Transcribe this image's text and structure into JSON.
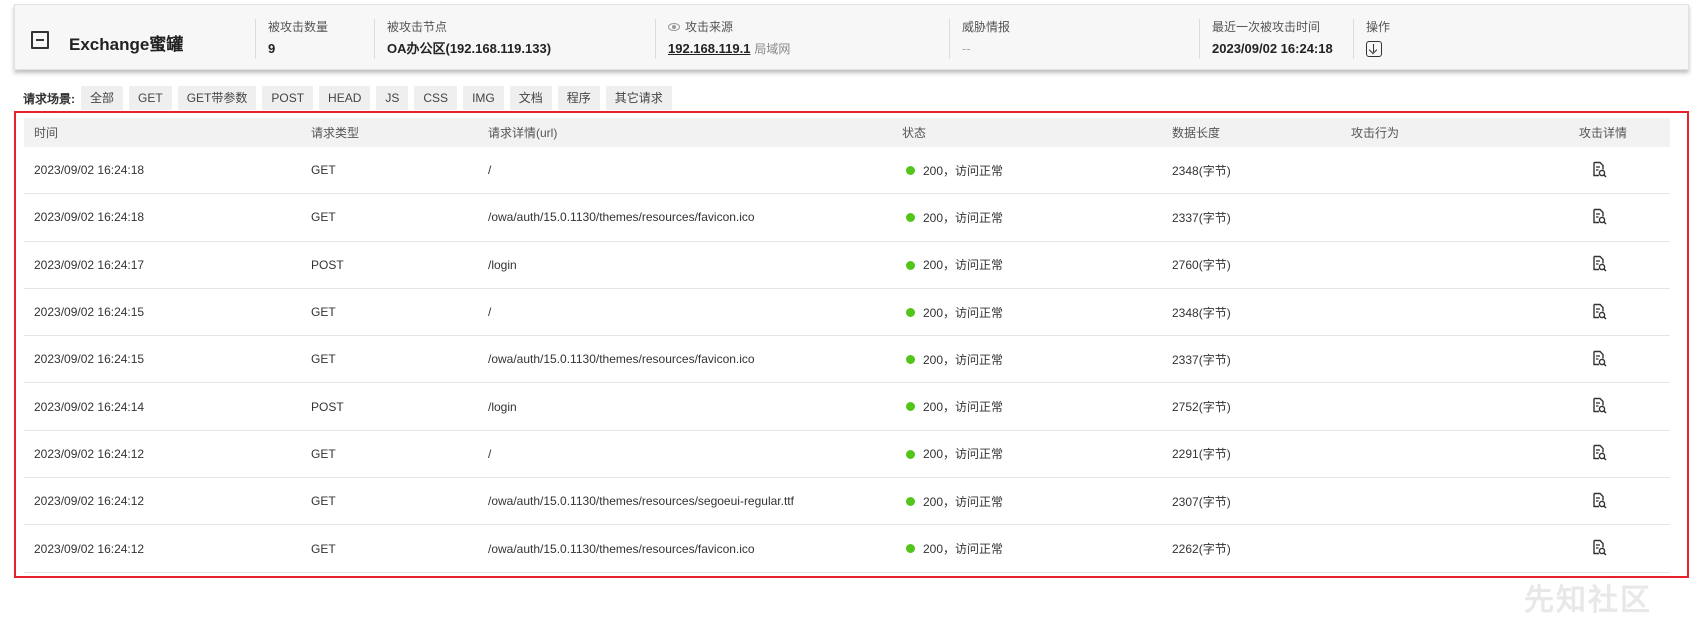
{
  "header": {
    "title": "Exchange蜜罐",
    "cols": [
      {
        "label": "被攻击数量",
        "value": "9"
      },
      {
        "label": "被攻击节点",
        "value": "OA办公区(192.168.119.133)"
      },
      {
        "label": "攻击来源",
        "value": "192.168.119.1",
        "tag": "局域网"
      },
      {
        "label": "威胁情报",
        "value": "--"
      },
      {
        "label": "最近一次被攻击时间",
        "value": "2023/09/02 16:24:18"
      },
      {
        "label": "操作"
      }
    ]
  },
  "filter": {
    "label": "请求场景:",
    "chips": [
      "全部",
      "GET",
      "GET带参数",
      "POST",
      "HEAD",
      "JS",
      "CSS",
      "IMG",
      "文档",
      "程序",
      "其它请求"
    ]
  },
  "table": {
    "headers": [
      "时间",
      "请求类型",
      "请求详情(url)",
      "状态",
      "数据长度",
      "攻击行为",
      "攻击详情"
    ],
    "rows": [
      {
        "time": "2023/09/02 16:24:18",
        "type": "GET",
        "url": "/",
        "status": "200，访问正常",
        "length": "2348(字节)",
        "behavior": ""
      },
      {
        "time": "2023/09/02 16:24:18",
        "type": "GET",
        "url": "/owa/auth/15.0.1130/themes/resources/favicon.ico",
        "status": "200，访问正常",
        "length": "2337(字节)",
        "behavior": ""
      },
      {
        "time": "2023/09/02 16:24:17",
        "type": "POST",
        "url": "/login",
        "status": "200，访问正常",
        "length": "2760(字节)",
        "behavior": ""
      },
      {
        "time": "2023/09/02 16:24:15",
        "type": "GET",
        "url": "/",
        "status": "200，访问正常",
        "length": "2348(字节)",
        "behavior": ""
      },
      {
        "time": "2023/09/02 16:24:15",
        "type": "GET",
        "url": "/owa/auth/15.0.1130/themes/resources/favicon.ico",
        "status": "200，访问正常",
        "length": "2337(字节)",
        "behavior": ""
      },
      {
        "time": "2023/09/02 16:24:14",
        "type": "POST",
        "url": "/login",
        "status": "200，访问正常",
        "length": "2752(字节)",
        "behavior": ""
      },
      {
        "time": "2023/09/02 16:24:12",
        "type": "GET",
        "url": "/",
        "status": "200，访问正常",
        "length": "2291(字节)",
        "behavior": ""
      },
      {
        "time": "2023/09/02 16:24:12",
        "type": "GET",
        "url": "/owa/auth/15.0.1130/themes/resources/segoeui-regular.ttf",
        "status": "200，访问正常",
        "length": "2307(字节)",
        "behavior": ""
      },
      {
        "time": "2023/09/02 16:24:12",
        "type": "GET",
        "url": "/owa/auth/15.0.1130/themes/resources/favicon.ico",
        "status": "200，访问正常",
        "length": "2262(字节)",
        "behavior": ""
      }
    ]
  },
  "watermark": "先知社区",
  "colors": {
    "status_ok": "#52c41a",
    "highlight_frame": "#e8202a"
  }
}
